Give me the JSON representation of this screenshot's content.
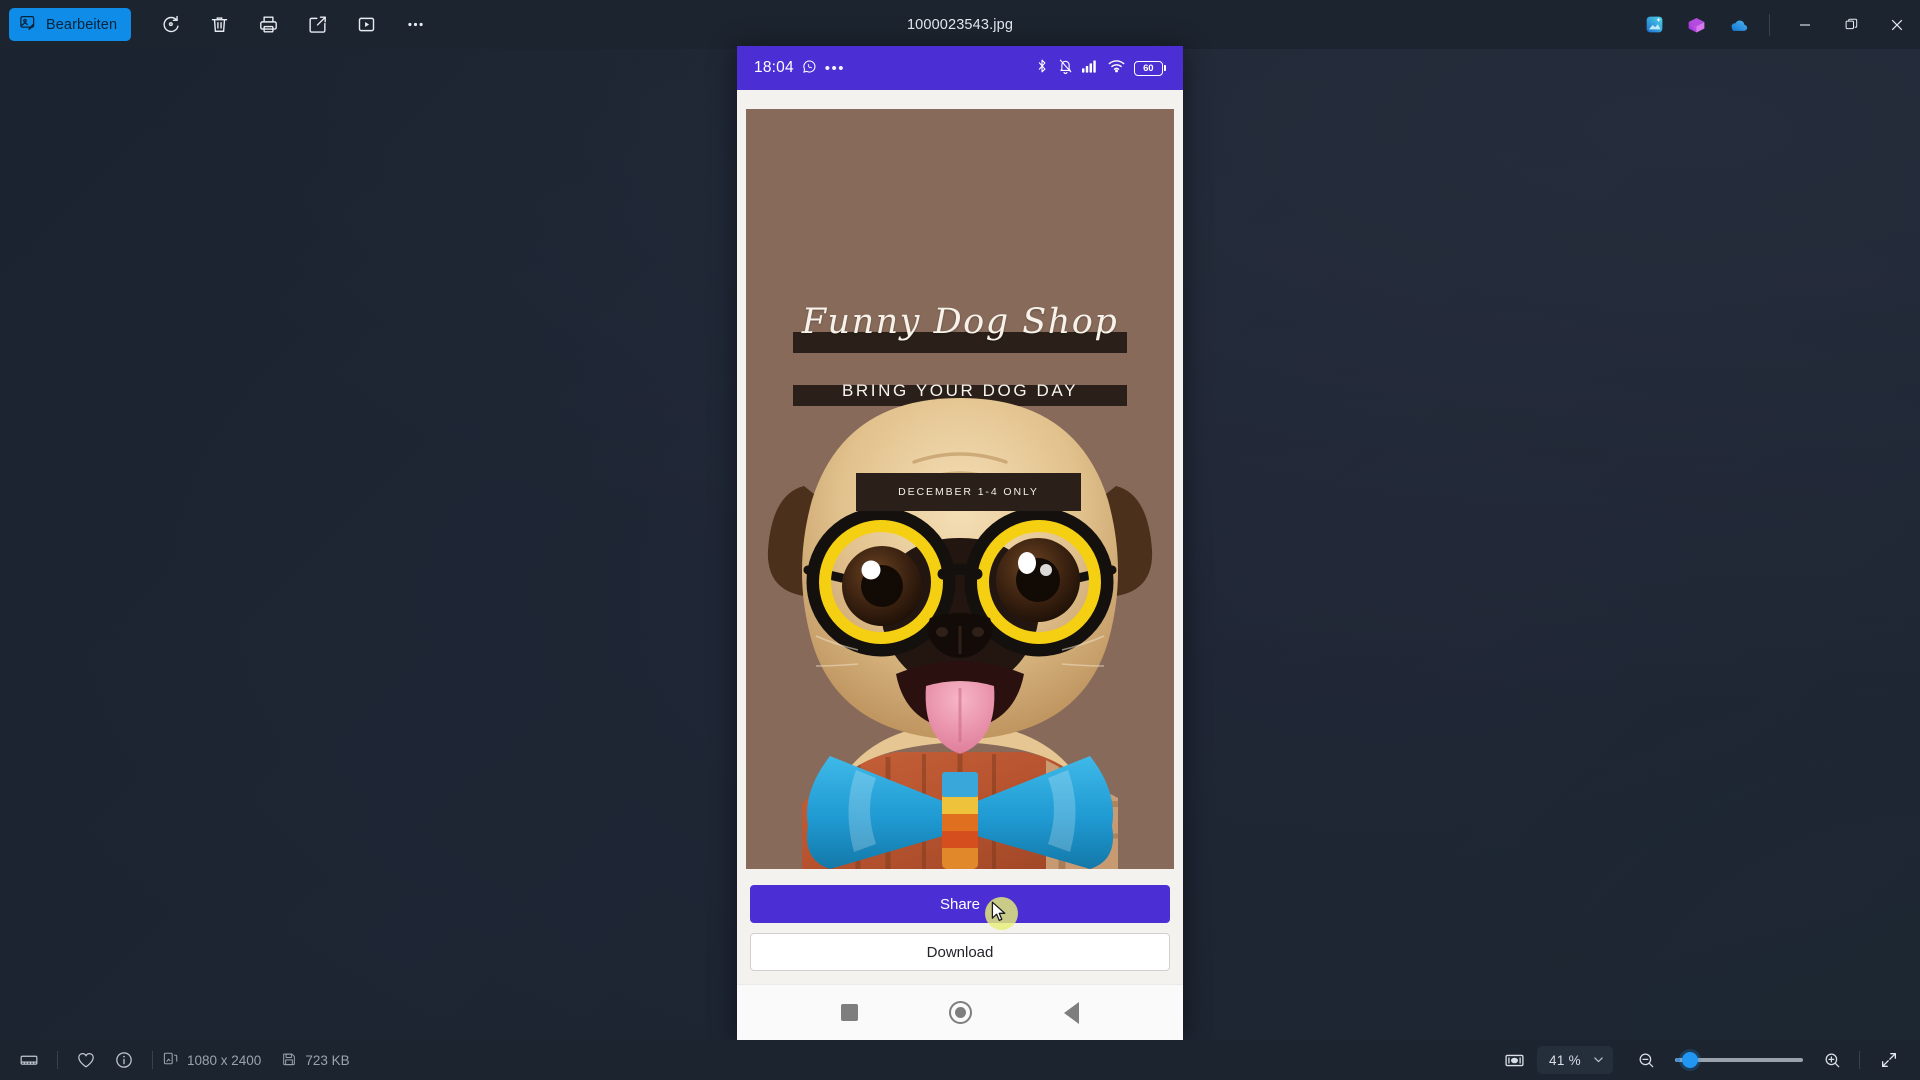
{
  "window": {
    "title": "1000023543.jpg",
    "edit_button_label": "Bearbeiten",
    "toolbar_icons": [
      {
        "name": "rotate-icon",
        "label": "Drehen"
      },
      {
        "name": "delete-icon",
        "label": "Löschen"
      },
      {
        "name": "print-icon",
        "label": "Drucken"
      },
      {
        "name": "share-icon",
        "label": "Teilen"
      },
      {
        "name": "slideshow-icon",
        "label": "Diashow"
      },
      {
        "name": "more-options-icon",
        "label": "Mehr anzeigen"
      }
    ],
    "tray_icons": [
      {
        "name": "photo-enhance-icon"
      },
      {
        "name": "designer-icon"
      },
      {
        "name": "onedrive-icon"
      }
    ],
    "controls": [
      {
        "name": "minimize-button",
        "glyph": "—"
      },
      {
        "name": "maximize-button",
        "glyph": "❐"
      },
      {
        "name": "close-button",
        "glyph": "✕"
      }
    ]
  },
  "phone": {
    "status_bar": {
      "time": "18:04",
      "overflow_dots": "•••",
      "battery_level": "60",
      "icons": [
        "whatsapp-icon",
        "bluetooth-icon",
        "mute-bell-icon",
        "cellular-signal-icon",
        "wifi-icon",
        "battery-icon"
      ]
    },
    "poster": {
      "title": "Funny Dog Shop",
      "subtitle": "BRING YOUR DOG DAY",
      "date_badge": "DECEMBER 1-4 ONLY",
      "background_color": "#876a5a",
      "banner_color": "#2b2019",
      "subject": "pug-dog-with-yellow-glasses-and-blue-bow-tie"
    },
    "actions": {
      "share_label": "Share",
      "share_color": "#4b2fd4",
      "download_label": "Download"
    },
    "navigation": [
      {
        "name": "android-recents-button",
        "glyph": "square"
      },
      {
        "name": "android-home-button",
        "glyph": "circle"
      },
      {
        "name": "android-back-button",
        "glyph": "triangle"
      }
    ]
  },
  "status_bar": {
    "filmstrip_label": "Filmstreifen",
    "favorite_label": "Favorit",
    "info_label": "Dateiinformationen",
    "dimensions": "1080 x 2400",
    "file_size": "723 KB",
    "zoom_level": "41 %",
    "fit_label": "An Fenster anpassen",
    "zoom_out_label": "Verkleinern",
    "zoom_in_label": "Vergrößern",
    "fullscreen_label": "Vollbild"
  }
}
